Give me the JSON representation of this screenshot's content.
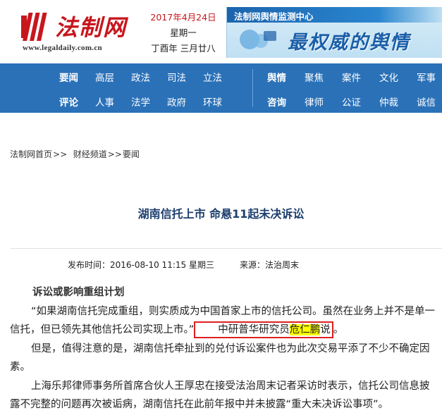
{
  "header": {
    "logo_text": "法制网",
    "logo_url": "www.legaldaily.com.cn",
    "date": "2017年4月24日",
    "weekday": "星期一",
    "lunar": "丁酉年 三月廿八",
    "banner_title": "法制网舆情监测中心",
    "banner_slogan": "最权威的舆情"
  },
  "nav": {
    "row1_left": [
      "要闻",
      "高层",
      "政法",
      "司法",
      "立法"
    ],
    "row2_left": [
      "评论",
      "人事",
      "法学",
      "政府",
      "环球"
    ],
    "row1_right": [
      "舆情",
      "聚焦",
      "案件",
      "文化",
      "军事"
    ],
    "row2_right": [
      "咨询",
      "律师",
      "公证",
      "仲裁",
      "诚信"
    ]
  },
  "breadcrumb": {
    "home": "法制网首页",
    "sep1": ">>",
    "channel": "财经频道",
    "sep2": ">>",
    "section": "要闻"
  },
  "article": {
    "title": "湖南信托上市 命悬11起未决诉讼",
    "published_label": "发布时间：2016-08-10 11:15 星期三",
    "source_label": "来源：法治周末",
    "subhead": "诉讼或影响重组计划",
    "p1_a": "“如果湖南信托完成重组，则实质成为中国首家上市的信托公司。虽然在业务上并不是单一信托，但已领先其他信托公司实现上市。”",
    "p1_box_a": "中研普华研究员",
    "p1_box_hl": "危仁鹏",
    "p1_box_b": "说",
    "p1_end": "。",
    "p2": "但是，值得注意的是，湖南信托牵扯到的兑付诉讼案件也为此次交易平添了不少不确定因素。",
    "p3": "上海乐邦律师事务所首席合伙人王厚忠在接受法治周末记者采访时表示，信托公司信息披露不完整的问题再次被诟病，湖南信托在此前年报中并未披露“重大未决诉讼事项”。"
  },
  "colors": {
    "nav_bg": "#2a71b8",
    "brand_red": "#c8161d",
    "title_blue": "#1d3e6e"
  }
}
